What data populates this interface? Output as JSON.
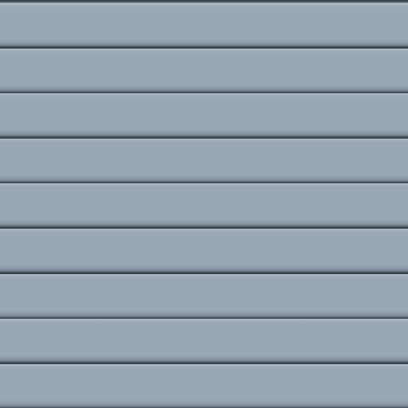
{
  "texture": {
    "slat_count": 9,
    "colors": {
      "face": "#9aa8b5",
      "highlight": "#b2bec9",
      "groove": "#353d45"
    }
  }
}
